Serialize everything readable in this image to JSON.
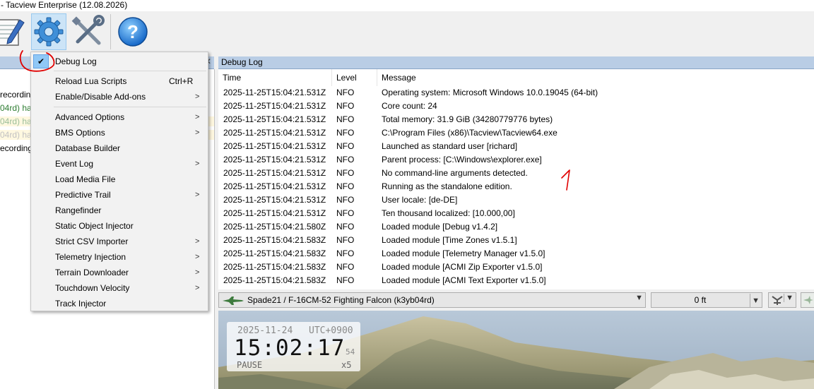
{
  "window": {
    "title": "- Tacview Enterprise (12.08.2026)"
  },
  "toolbar": {
    "buttons": [
      {
        "icon": "notepad-pencil-icon"
      },
      {
        "icon": "gear-icon"
      },
      {
        "icon": "tools-icon"
      },
      {
        "icon": "help-icon"
      }
    ]
  },
  "left_panel": {
    "lines": [
      {
        "text": "recordin",
        "color": "#000000"
      },
      {
        "text": "04rd) ha",
        "color": "#2e7d32"
      },
      {
        "text": "04rd) ha",
        "color": "#9bbf9b"
      },
      {
        "text": "04rd) ha",
        "color": "#c2c2c2"
      },
      {
        "text": "ecording",
        "color": "#000000"
      }
    ]
  },
  "menu": {
    "items": [
      {
        "label": "Debug Log",
        "checked": true,
        "shortcut": "",
        "submenu": false
      },
      {
        "label": "Reload Lua Scripts",
        "checked": false,
        "shortcut": "Ctrl+R",
        "submenu": false
      },
      {
        "label": "Enable/Disable Add-ons",
        "checked": false,
        "shortcut": "",
        "submenu": true
      },
      {
        "label": "Advanced Options",
        "checked": false,
        "shortcut": "",
        "submenu": true
      },
      {
        "label": "BMS Options",
        "checked": false,
        "shortcut": "",
        "submenu": true
      },
      {
        "label": "Database Builder",
        "checked": false,
        "shortcut": "",
        "submenu": false
      },
      {
        "label": "Event Log",
        "checked": false,
        "shortcut": "",
        "submenu": true
      },
      {
        "label": "Load Media File",
        "checked": false,
        "shortcut": "",
        "submenu": false
      },
      {
        "label": "Predictive Trail",
        "checked": false,
        "shortcut": "",
        "submenu": true
      },
      {
        "label": "Rangefinder",
        "checked": false,
        "shortcut": "",
        "submenu": false
      },
      {
        "label": "Static Object Injector",
        "checked": false,
        "shortcut": "",
        "submenu": false
      },
      {
        "label": "Strict CSV Importer",
        "checked": false,
        "shortcut": "",
        "submenu": true
      },
      {
        "label": "Telemetry Injection",
        "checked": false,
        "shortcut": "",
        "submenu": true
      },
      {
        "label": "Terrain Downloader",
        "checked": false,
        "shortcut": "",
        "submenu": true
      },
      {
        "label": "Touchdown Velocity",
        "checked": false,
        "shortcut": "",
        "submenu": true
      },
      {
        "label": "Track Injector",
        "checked": false,
        "shortcut": "",
        "submenu": false
      }
    ],
    "submenu_arrow": ">",
    "check_glyph": "✔"
  },
  "debug_log": {
    "title": "Debug Log",
    "columns": [
      "Time",
      "Level",
      "Message"
    ],
    "rows": [
      {
        "time": "2025-11-25T15:04:21.531Z",
        "level": "NFO",
        "message": "Operating system: Microsoft Windows 10.0.19045 (64-bit)"
      },
      {
        "time": "2025-11-25T15:04:21.531Z",
        "level": "NFO",
        "message": "Core count: 24"
      },
      {
        "time": "2025-11-25T15:04:21.531Z",
        "level": "NFO",
        "message": "Total memory: 31.9 GiB (34280779776 bytes)"
      },
      {
        "time": "2025-11-25T15:04:21.531Z",
        "level": "NFO",
        "message": "C:\\Program Files (x86)\\Tacview\\Tacview64.exe"
      },
      {
        "time": "2025-11-25T15:04:21.531Z",
        "level": "NFO",
        "message": "Launched as standard user [richard]"
      },
      {
        "time": "2025-11-25T15:04:21.531Z",
        "level": "NFO",
        "message": "Parent process: [C:\\Windows\\explorer.exe]"
      },
      {
        "time": "2025-11-25T15:04:21.531Z",
        "level": "NFO",
        "message": "No command-line arguments detected."
      },
      {
        "time": "2025-11-25T15:04:21.531Z",
        "level": "NFO",
        "message": "Running as the standalone edition."
      },
      {
        "time": "2025-11-25T15:04:21.531Z",
        "level": "NFO",
        "message": "User locale: [de-DE]"
      },
      {
        "time": "2025-11-25T15:04:21.531Z",
        "level": "NFO",
        "message": "Ten thousand localized: [10.000,00]"
      },
      {
        "time": "2025-11-25T15:04:21.580Z",
        "level": "NFO",
        "message": "Loaded module [Debug v1.4.2]"
      },
      {
        "time": "2025-11-25T15:04:21.583Z",
        "level": "NFO",
        "message": "Loaded module [Time Zones v1.5.1]"
      },
      {
        "time": "2025-11-25T15:04:21.583Z",
        "level": "NFO",
        "message": "Loaded module [Telemetry Manager v1.5.0]"
      },
      {
        "time": "2025-11-25T15:04:21.583Z",
        "level": "NFO",
        "message": "Loaded module [ACMI Zip Exporter v1.5.0]"
      },
      {
        "time": "2025-11-25T15:04:21.583Z",
        "level": "NFO",
        "message": "Loaded module [ACMI Text Exporter v1.5.0]"
      }
    ]
  },
  "annotations": {
    "number": "1"
  },
  "object_bar": {
    "selected_object": "Spade21 / F-16CM-52 Fighting Falcon (k3yb04rd)",
    "altitude": "0 ft"
  },
  "clock": {
    "date": "2025-11-24",
    "timezone": "UTC+0900",
    "time": "15:02:17",
    "seconds_fraction": "54",
    "state": "PAUSE",
    "speed": "x5"
  },
  "colors": {
    "accent": "#62a2e4",
    "header": "#b9cde5",
    "annotation": "#e00000"
  }
}
